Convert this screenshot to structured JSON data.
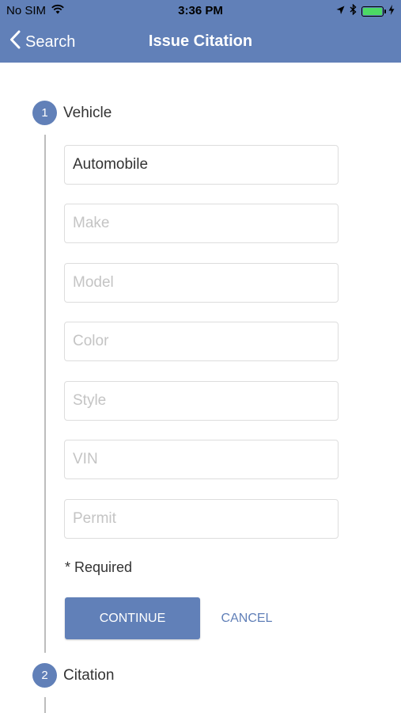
{
  "status_bar": {
    "carrier": "No SIM",
    "time": "3:36 PM",
    "battery_color": "#4cd964",
    "icons": [
      "wifi-icon",
      "location-arrow-icon",
      "bluetooth-icon",
      "battery-icon",
      "charging-bolt-icon"
    ]
  },
  "nav": {
    "back_label": "Search",
    "title": "Issue Citation",
    "color": "#6180b8"
  },
  "steps": [
    {
      "number": "1",
      "label": "Vehicle"
    },
    {
      "number": "2",
      "label": "Citation"
    }
  ],
  "form": {
    "vehicle_type_value": "Automobile",
    "make_placeholder": "Make",
    "model_placeholder": "Model",
    "color_placeholder": "Color",
    "style_placeholder": "Style",
    "vin_placeholder": "VIN",
    "permit_placeholder": "Permit",
    "required_note": "* Required",
    "continue_label": "CONTINUE",
    "cancel_label": "CANCEL"
  }
}
